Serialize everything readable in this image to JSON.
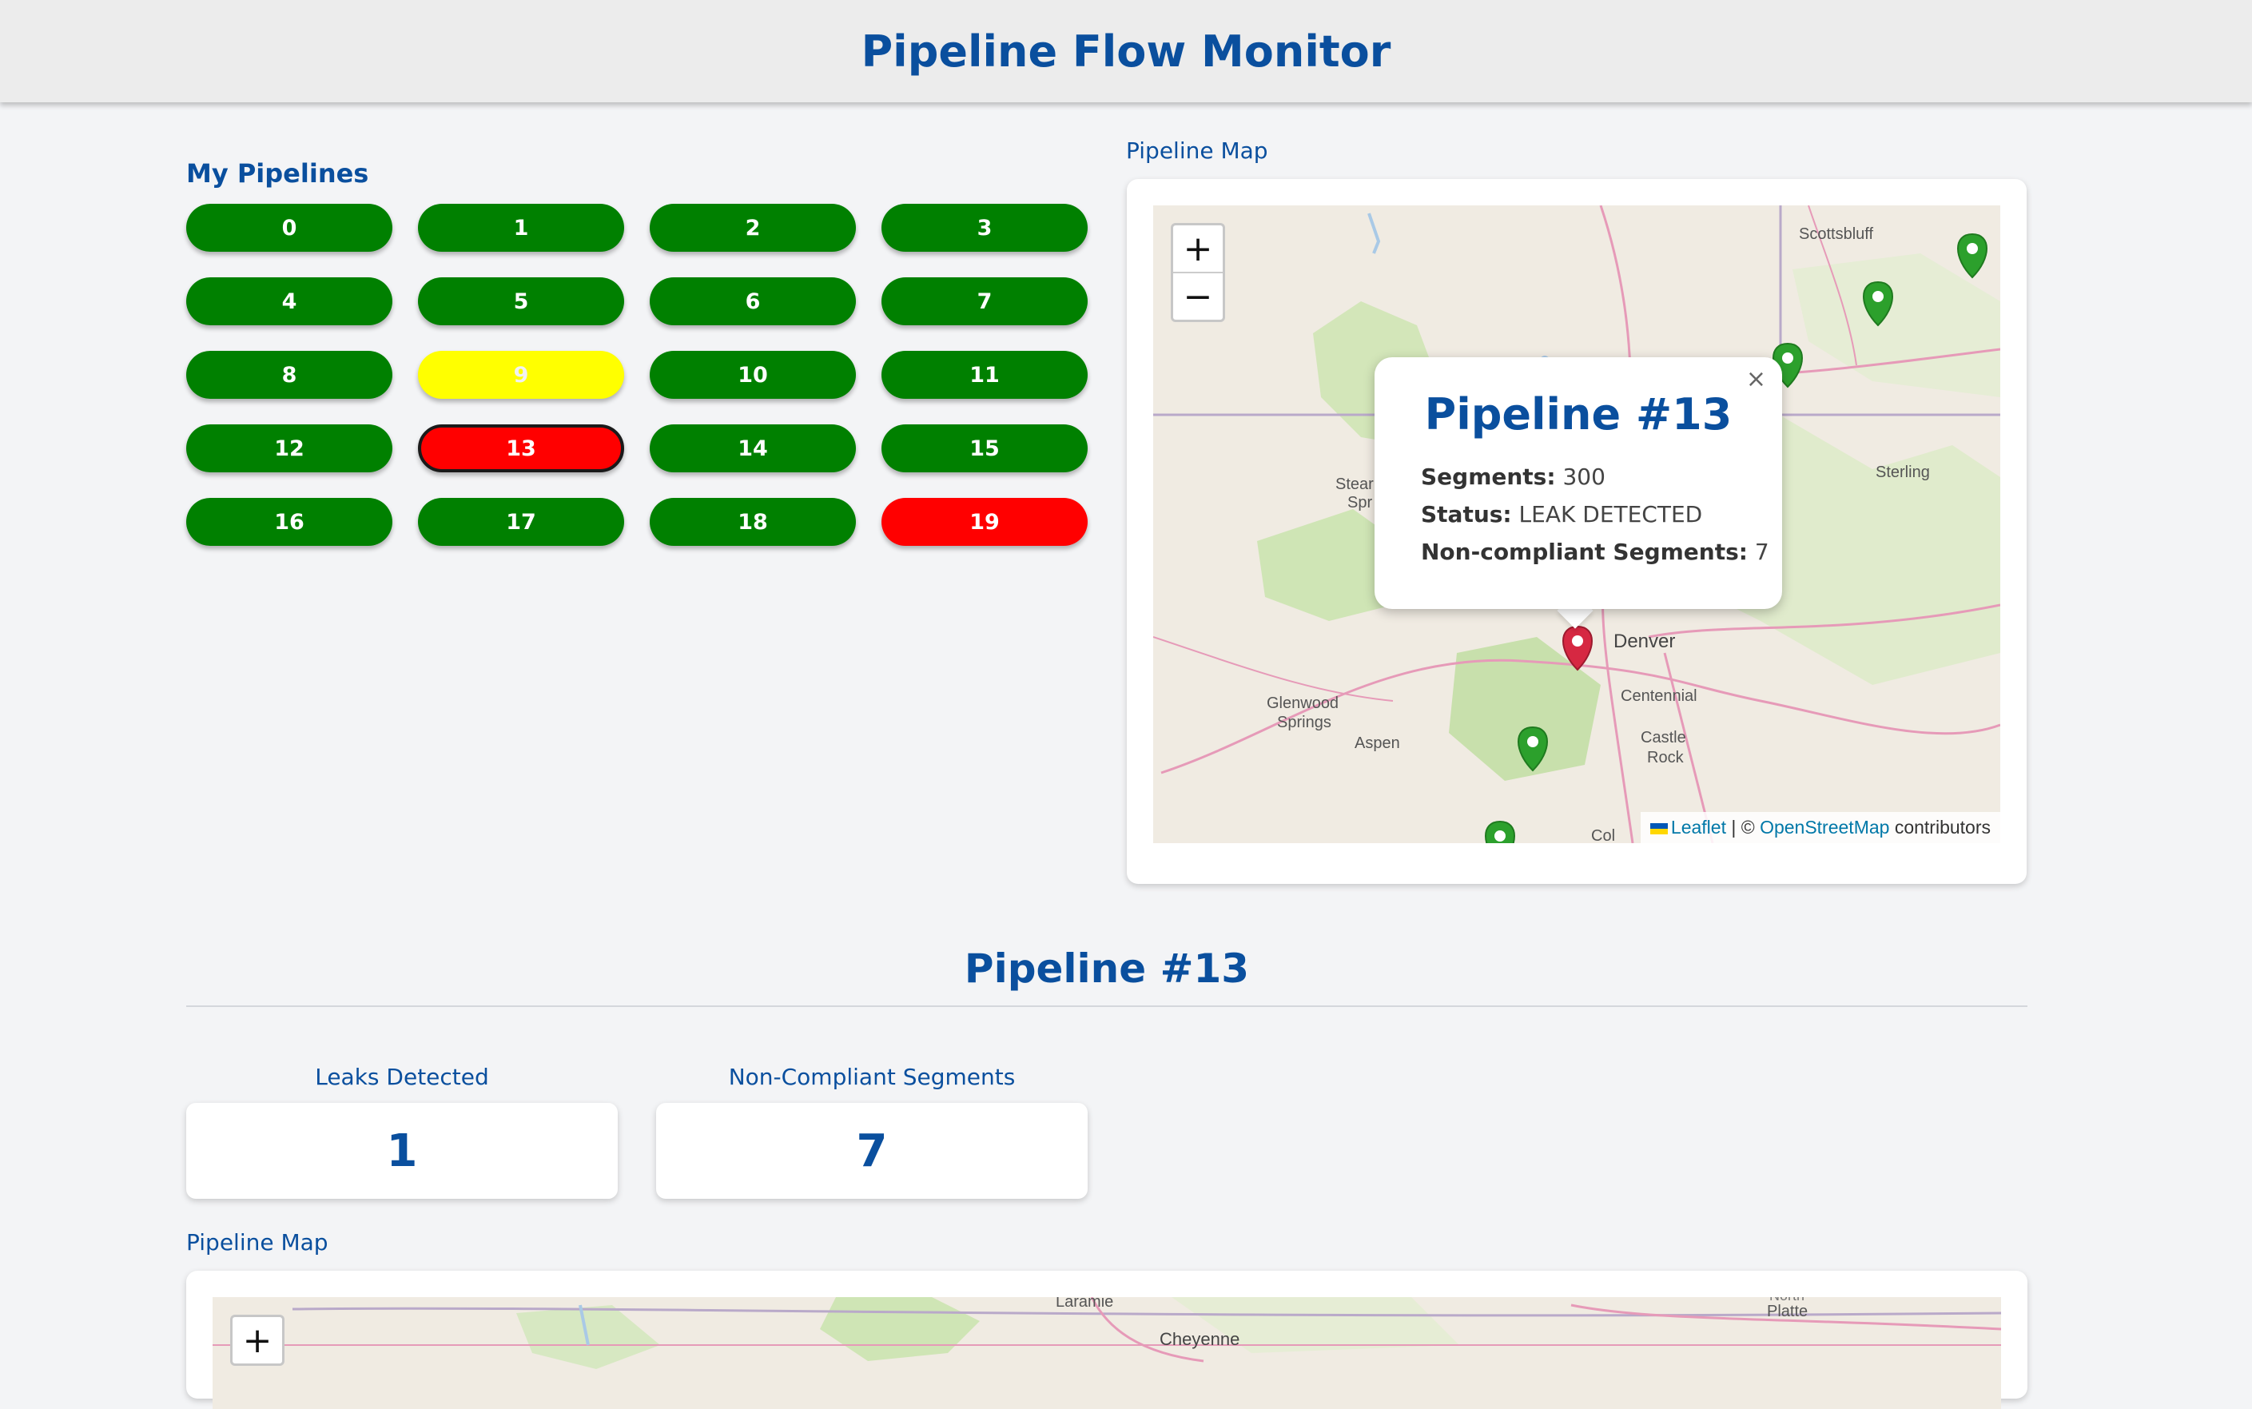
{
  "header": {
    "title": "Pipeline Flow Monitor"
  },
  "pipelines": {
    "title": "My Pipelines",
    "items": [
      {
        "label": "0",
        "status": "ok"
      },
      {
        "label": "1",
        "status": "ok"
      },
      {
        "label": "2",
        "status": "ok"
      },
      {
        "label": "3",
        "status": "ok"
      },
      {
        "label": "4",
        "status": "ok"
      },
      {
        "label": "5",
        "status": "ok"
      },
      {
        "label": "6",
        "status": "ok"
      },
      {
        "label": "7",
        "status": "ok"
      },
      {
        "label": "8",
        "status": "ok"
      },
      {
        "label": "9",
        "status": "warn"
      },
      {
        "label": "10",
        "status": "ok"
      },
      {
        "label": "11",
        "status": "ok"
      },
      {
        "label": "12",
        "status": "ok"
      },
      {
        "label": "13",
        "status": "leak",
        "selected": true
      },
      {
        "label": "14",
        "status": "ok"
      },
      {
        "label": "15",
        "status": "ok"
      },
      {
        "label": "16",
        "status": "ok"
      },
      {
        "label": "17",
        "status": "ok"
      },
      {
        "label": "18",
        "status": "ok"
      },
      {
        "label": "19",
        "status": "leak"
      }
    ],
    "colors": {
      "ok": "#008000",
      "warn": "#ffff00",
      "leak": "#ff0000"
    }
  },
  "map_top": {
    "label": "Pipeline Map",
    "zoom_in": "+",
    "zoom_out": "−",
    "places": [
      "Scottsbluff",
      "Sterling",
      "Denver",
      "Centennial",
      "Castle",
      "Rock",
      "Glenwood",
      "Springs",
      "Aspen",
      "Stear",
      "Spr",
      "Col"
    ],
    "attribution": {
      "leaflet": "Leaflet",
      "sep": " | © ",
      "osm": "OpenStreetMap",
      "suffix": " contributors"
    },
    "popup": {
      "title": "Pipeline #13",
      "close": "×",
      "segments_label": "Segments:",
      "segments_value": "300",
      "status_label": "Status:",
      "status_value": "LEAK DETECTED",
      "noncompliant_label": "Non-compliant Segments:",
      "noncompliant_value": "7"
    }
  },
  "detail": {
    "title": "Pipeline #13",
    "leaks_label": "Leaks Detected",
    "leaks_value": "1",
    "noncompliant_label": "Non-Compliant Segments",
    "noncompliant_value": "7"
  },
  "map_bottom": {
    "label": "Pipeline Map",
    "zoom_in": "+",
    "places": [
      "Laramie",
      "Cheyenne",
      "North",
      "Platte"
    ]
  }
}
